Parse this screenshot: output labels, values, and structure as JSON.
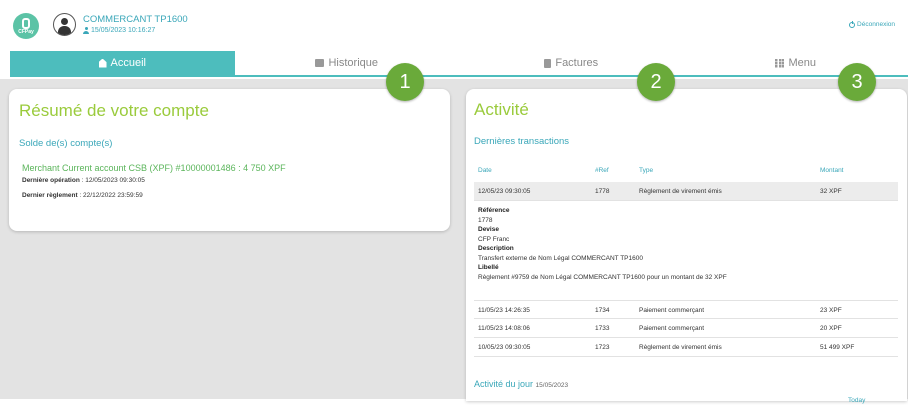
{
  "header": {
    "logo_text": "CFPay",
    "merchant_name": "COMMERCANT TP1600",
    "merchant_datetime": "15/05/2023 10:16:27",
    "logout_label": "Déconnexion"
  },
  "nav": {
    "tabs": [
      {
        "label": "Accueil",
        "icon": "home-icon",
        "active": true
      },
      {
        "label": "Historique",
        "icon": "history-icon",
        "active": false
      },
      {
        "label": "Factures",
        "icon": "invoice-icon",
        "active": false
      },
      {
        "label": "Menu",
        "icon": "grid-icon",
        "active": false
      }
    ]
  },
  "summary": {
    "title": "Résumé de votre compte",
    "balance_title": "Solde de(s) compte(s)",
    "account_line": "Merchant Current account CSB (XPF) #10000001486 : 4 750 XPF",
    "last_operation_label": "Dernière opération",
    "last_operation_value": " : 12/05/2023 09:30:05",
    "last_settlement_label": "Dernier règlement",
    "last_settlement_value": " : 22/12/2022 23:59:59"
  },
  "activity": {
    "title": "Activité",
    "recent_title": "Dernières transactions",
    "columns": [
      "Date",
      "#Ref",
      "Type",
      "Montant"
    ],
    "rows": [
      {
        "date": "12/05/23 09:30:05",
        "ref": "1778",
        "type": "Règlement de virement émis",
        "amount": "32 XPF"
      },
      {
        "date": "11/05/23 14:26:35",
        "ref": "1734",
        "type": "Paiement commerçant",
        "amount": "23 XPF"
      },
      {
        "date": "11/05/23 14:08:06",
        "ref": "1733",
        "type": "Paiement commerçant",
        "amount": "20 XPF"
      },
      {
        "date": "10/05/23 09:30:05",
        "ref": "1723",
        "type": "Règlement de virement émis",
        "amount": "51 499 XPF"
      }
    ],
    "detail": {
      "reference_label": "Référence",
      "reference_value": "1778",
      "currency_label": "Devise",
      "currency_value": "CFP Franc",
      "description_label": "Description",
      "description_value": "Transfert externe de Nom Légal COMMERCANT TP1600",
      "libelle_label": "Libellé",
      "libelle_value": "Règlement #9759 de Nom Légal COMMERCANT TP1600 pour un montant de 32 XPF"
    },
    "day_title": "Activité du jour",
    "day_date": "15/05/2023",
    "today_label": "Today"
  },
  "badges": [
    "1",
    "2",
    "3"
  ]
}
